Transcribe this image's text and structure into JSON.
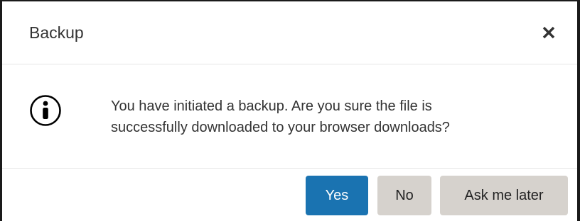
{
  "dialog": {
    "title": "Backup",
    "close_icon": "close-icon",
    "message_line1": "You have initiated a backup. Are you sure the file is",
    "message_line2": "successfully downloaded to your browser downloads?",
    "info_icon": "info-circle-icon",
    "buttons": {
      "yes": "Yes",
      "no": "No",
      "later": "Ask me later"
    }
  },
  "colors": {
    "primary": "#1a73b1",
    "secondary": "#d6d2cd",
    "text": "#333333"
  }
}
